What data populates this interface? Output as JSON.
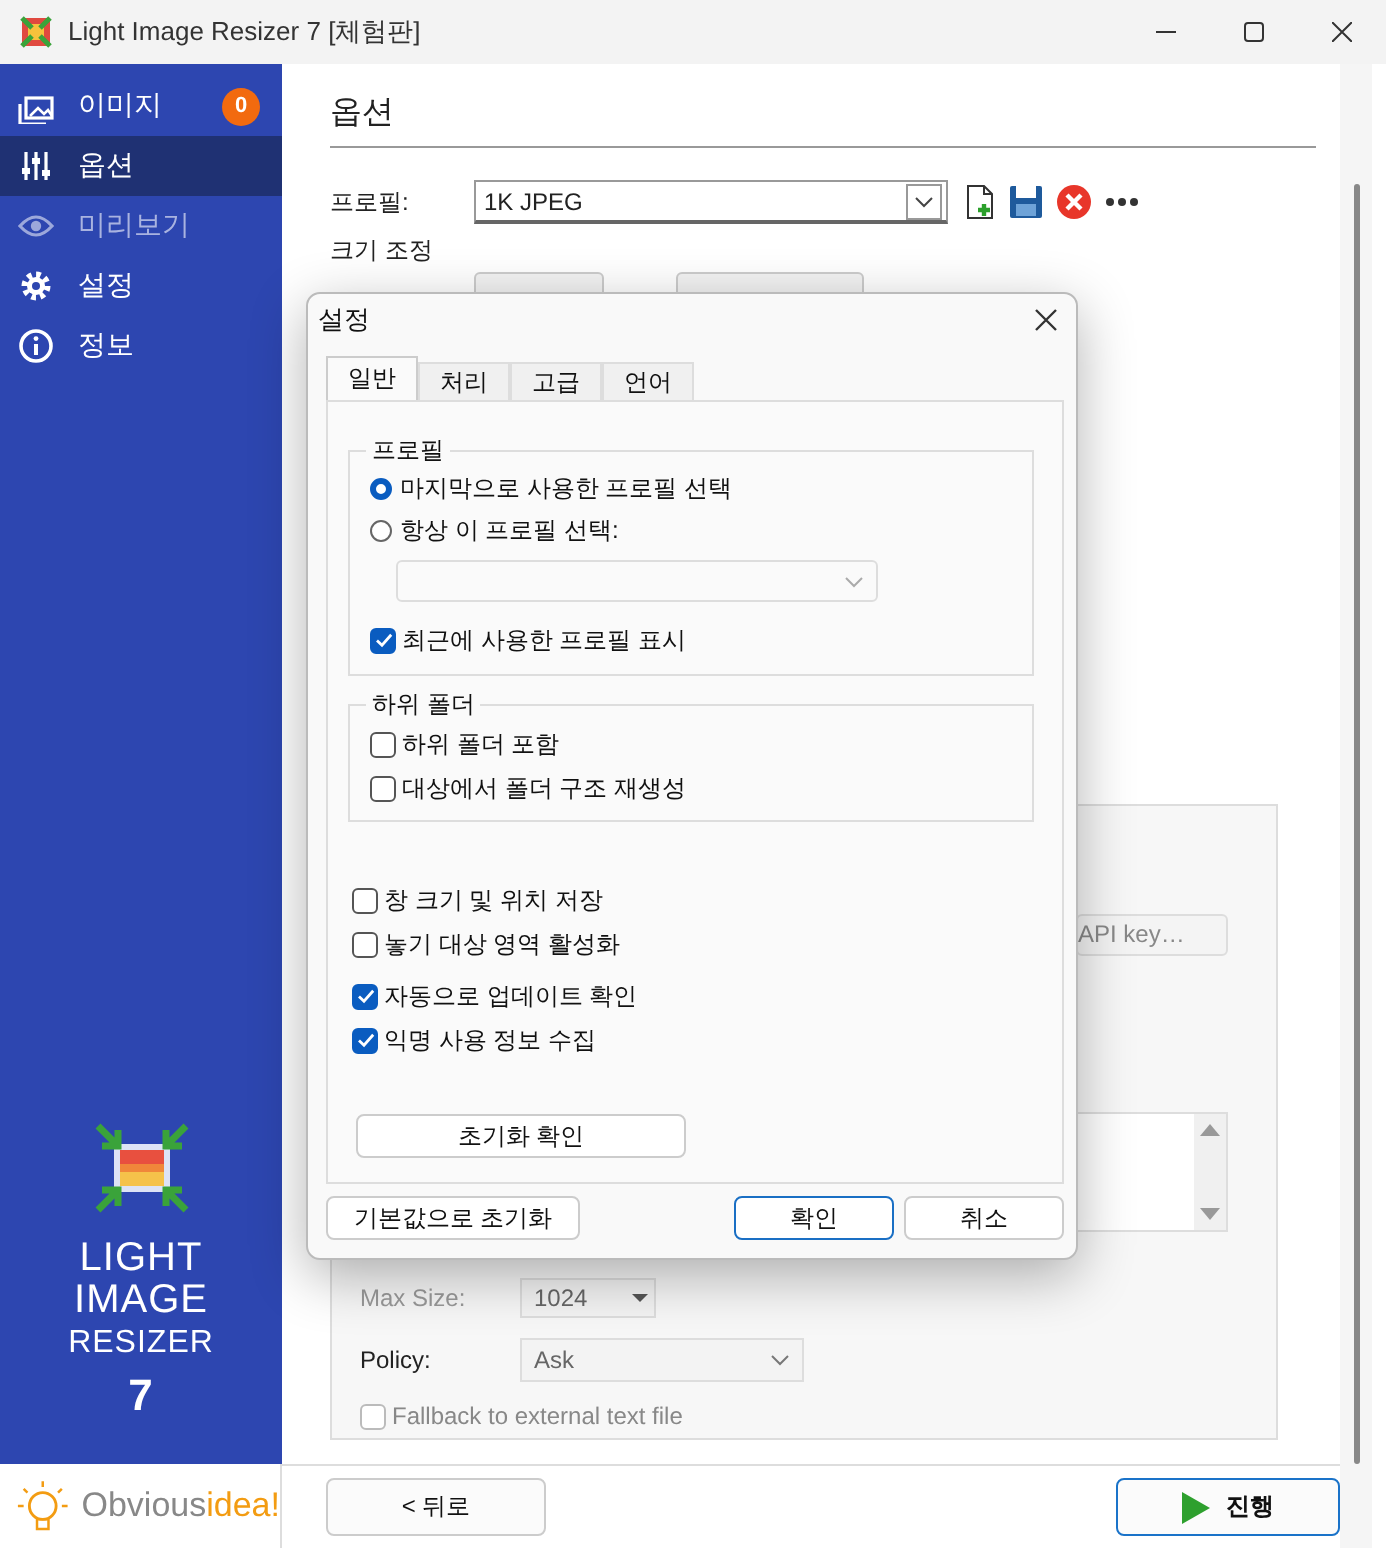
{
  "window": {
    "title": "Light Image Resizer 7  [체험판]"
  },
  "sidebar": {
    "items": [
      {
        "label": "이미지",
        "badge": "0",
        "selected": false,
        "disabled": false
      },
      {
        "label": "옵션",
        "selected": true,
        "disabled": false
      },
      {
        "label": "미리보기",
        "selected": false,
        "disabled": true
      },
      {
        "label": "설정",
        "selected": false,
        "disabled": false
      },
      {
        "label": "정보",
        "selected": false,
        "disabled": false
      }
    ],
    "logo_lines": [
      "LIGHT",
      "IMAGE",
      "RESIZER",
      "7"
    ],
    "brand": "Obvious",
    "brand_accent": "idea!"
  },
  "main": {
    "heading": "옵션",
    "profile": {
      "label": "프로필:",
      "value": "1K JPEG"
    },
    "section": "크기 조정",
    "group": {
      "api_button": "API key…",
      "max_size": {
        "label": "Max Size:",
        "value": "1024"
      },
      "policy": {
        "label": "Policy:",
        "value": "Ask"
      },
      "fallback": {
        "label": "Fallback to external text file",
        "checked": false,
        "disabled": true
      }
    },
    "back_button": "< 뒤로",
    "run_button": "진행"
  },
  "dialog": {
    "title": "설정",
    "tabs": [
      {
        "label": "일반",
        "selected": true
      },
      {
        "label": "처리",
        "selected": false
      },
      {
        "label": "고급",
        "selected": false
      },
      {
        "label": "언어",
        "selected": false
      }
    ],
    "profile_group": {
      "title": "프로필",
      "options": [
        {
          "label": "마지막으로 사용한 프로필 선택",
          "selected": true
        },
        {
          "label": "항상 이 프로필 선택:",
          "selected": false
        }
      ],
      "show_recent": {
        "label": "최근에 사용한 프로필 표시",
        "checked": true
      }
    },
    "subfolder_group": {
      "title": "하위 폴더",
      "checkboxes": [
        {
          "label": "하위 폴더 포함",
          "checked": false
        },
        {
          "label": "대상에서 폴더 구조 재생성",
          "checked": false
        }
      ]
    },
    "checkboxes": [
      {
        "label": "창 크기 및 위치 저장",
        "checked": false
      },
      {
        "label": "놓기 대상 영역 활성화",
        "checked": false
      },
      {
        "label": "자동으로 업데이트 확인",
        "checked": true
      },
      {
        "label": "익명 사용 정보 수집",
        "checked": true
      }
    ],
    "reset_button": "초기화 확인",
    "buttons": [
      {
        "label": "기본값으로 초기화",
        "default": false
      },
      {
        "label": "확인",
        "default": true
      },
      {
        "label": "취소",
        "default": false
      }
    ]
  }
}
